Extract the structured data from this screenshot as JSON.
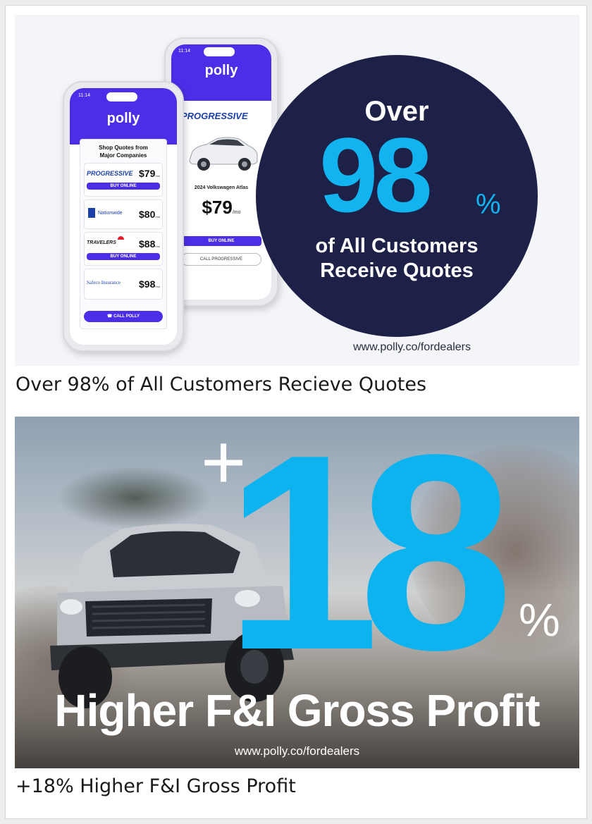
{
  "card1": {
    "phone_back": {
      "time": "11:14",
      "logo": "polly",
      "brand": "PROGRESSIVE",
      "car_name": "2024 Volkswagen Atlas",
      "price": "$79",
      "price_unit": "/mo",
      "buy_button": "BUY ONLINE",
      "call_button": "CALL PROGRESSIVE"
    },
    "phone_front": {
      "time": "11:14",
      "logo": "polly",
      "heading_line1": "Shop Quotes from",
      "heading_line2": "Major Companies",
      "quotes": [
        {
          "brand": "PROGRESSIVE",
          "price": "$79",
          "unit": "/mo",
          "button": "BUY ONLINE"
        },
        {
          "brand": "Nationwide",
          "price": "$80",
          "unit": "/mo",
          "button": ""
        },
        {
          "brand": "TRAVELERS",
          "price": "$88",
          "unit": "/mo",
          "button": "BUY ONLINE"
        },
        {
          "brand": "Safeco Insurance",
          "price": "$98",
          "unit": "/mo",
          "button": ""
        }
      ],
      "call_button": "CALL POLLY"
    },
    "badge": {
      "over": "Over",
      "number": "98",
      "percent": "%",
      "line1": "of All Customers",
      "line2": "Receive Quotes"
    },
    "url": "www.polly.co/fordealers"
  },
  "caption1": "Over 98% of All Customers Recieve Quotes",
  "card2": {
    "plus": "+",
    "number": "18",
    "percent": "%",
    "headline": "Higher F&I Gross Profit",
    "url": "www.polly.co/fordealers"
  },
  "caption2": "+18% Higher F&I Gross Profit",
  "colors": {
    "polly_purple": "#4b2ee8",
    "navy": "#1e2147",
    "cyan": "#12b4f0"
  }
}
